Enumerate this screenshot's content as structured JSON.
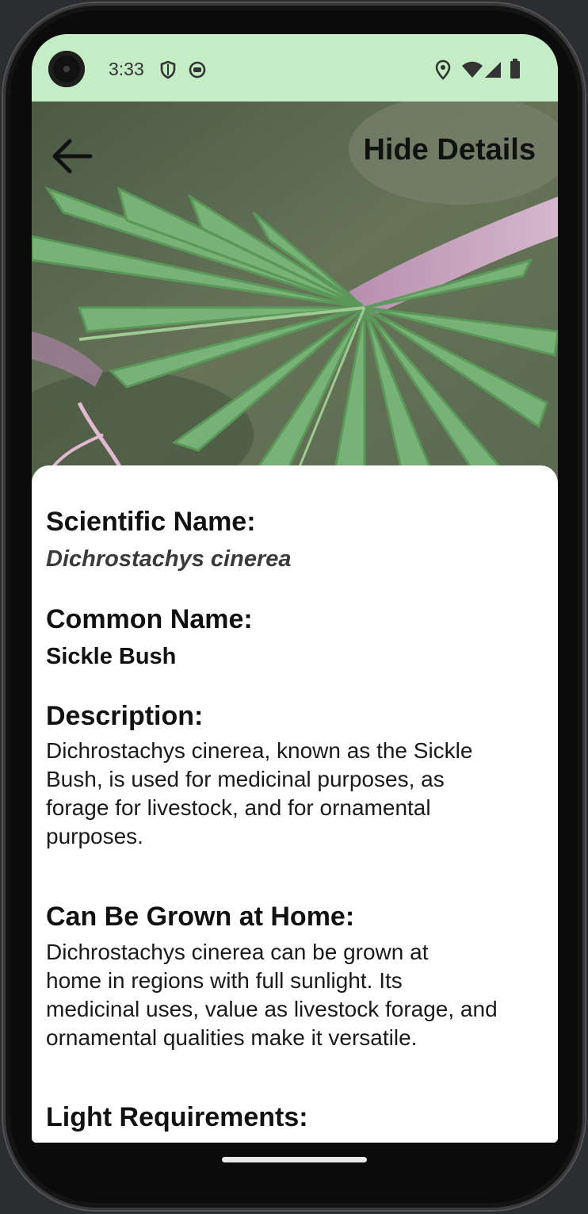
{
  "status_bar": {
    "time": "3:33",
    "left_icons": [
      "shield-icon",
      "face-icon"
    ],
    "right_icons": [
      "location-icon",
      "wifi-icon",
      "signal-icon",
      "battery-icon"
    ]
  },
  "header": {
    "back_icon": "arrow-left-icon",
    "toggle_label": "Hide Details"
  },
  "details": {
    "scientific_label": "Scientific Name:",
    "scientific_value": "Dichrostachys cinerea",
    "common_label": "Common Name:",
    "common_value": "Sickle Bush",
    "description_label": "Description:",
    "description_lines": [
      "Dichrostachys cinerea, known as the Sickle",
      "Bush, is used for medicinal purposes, as",
      "forage for livestock, and for ornamental",
      "purposes."
    ],
    "home_label": "Can Be Grown at Home:",
    "home_lines": [
      "Dichrostachys cinerea can be grown at",
      "home in regions with full sunlight. Its",
      "medicinal uses, value as livestock forage, and",
      "ornamental qualities make it versatile."
    ],
    "light_label": "Light Requirements:"
  },
  "colors": {
    "status_bar_bg": "#c5edc5",
    "leaf_green": "#6aa86a",
    "stem_pink": "#c9a3bf"
  }
}
